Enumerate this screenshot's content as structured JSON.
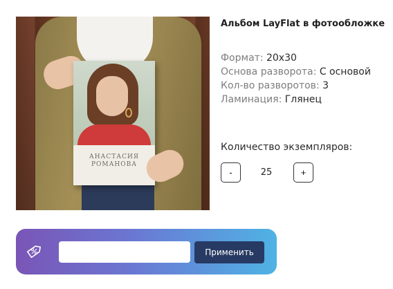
{
  "product": {
    "title": "Альбом LayFlat в фотообложке",
    "image_alt": "Женщина держит фотоальбом",
    "cover": {
      "name_line1": "АНАСТАСИЯ",
      "name_line2": "РОМАНОВА"
    },
    "specs": [
      {
        "label": "Формат",
        "value": "20x30"
      },
      {
        "label": "Основа разворота",
        "value": "С основой"
      },
      {
        "label": "Кол-во разворотов",
        "value": "3"
      },
      {
        "label": "Ламинация",
        "value": "Глянец"
      }
    ]
  },
  "quantity": {
    "label": "Количество экземпляров:",
    "minus": "-",
    "plus": "+",
    "value": "25"
  },
  "promo": {
    "icon": "discount-percent-icon",
    "input_value": "",
    "placeholder": "",
    "apply_label": "Применить",
    "gradient_start": "#7a55b6",
    "gradient_end": "#4fb3e4",
    "button_color": "#273a63"
  }
}
